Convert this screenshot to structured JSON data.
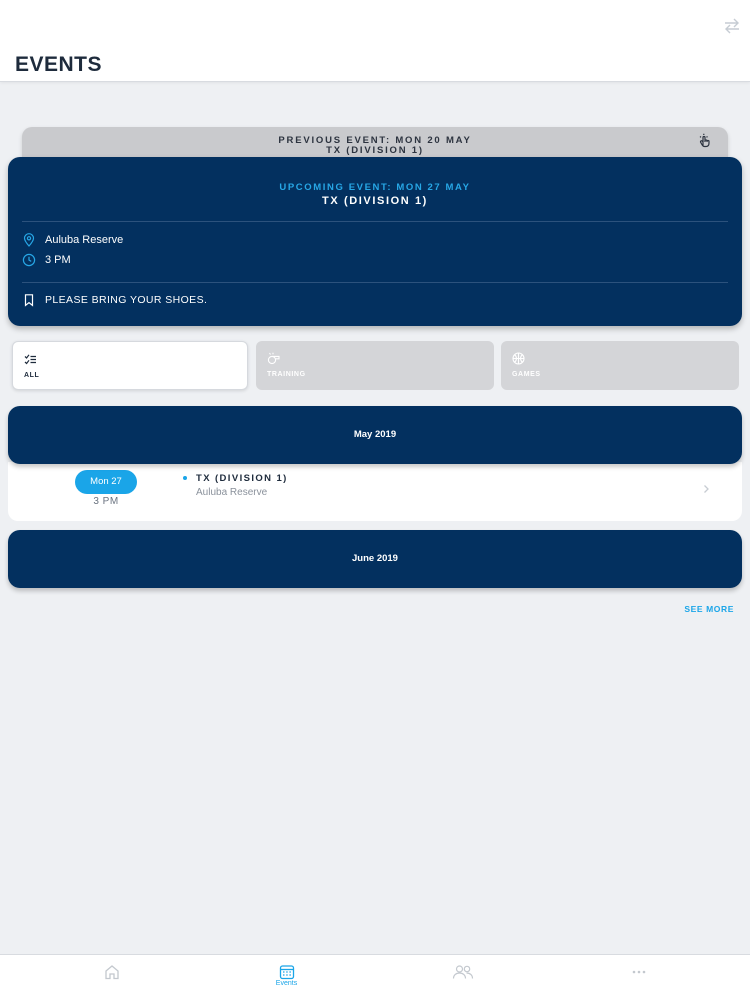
{
  "header": {
    "title": "EVENTS",
    "switch_icon": "swap-arrows-icon"
  },
  "previous_event": {
    "label": "PREVIOUS EVENT: MON 20 MAY",
    "title": "TX (DIVISION 1)",
    "icon": "tap-hand-icon"
  },
  "upcoming_event": {
    "label": "UPCOMING EVENT: MON 27 MAY",
    "title": "TX (DIVISION 1)",
    "location": "Auluba Reserve",
    "time": "3 PM",
    "note": "PLEASE BRING YOUR SHOES.",
    "accent_color": "#27a7e6"
  },
  "filters": [
    {
      "label": "ALL",
      "icon": "checklist-icon",
      "active": true
    },
    {
      "label": "TRAINING",
      "icon": "whistle-icon",
      "active": false
    },
    {
      "label": "GAMES",
      "icon": "ball-icon",
      "active": false
    }
  ],
  "months": [
    {
      "label": "May 2019",
      "events": [
        {
          "date": "Mon 27",
          "time": "3 PM",
          "title": "TX (DIVISION 1)",
          "venue": "Auluba Reserve"
        }
      ]
    },
    {
      "label": "June 2019",
      "events": []
    }
  ],
  "see_more": "SEE MORE",
  "tabbar": [
    {
      "label": "",
      "icon": "home-icon",
      "active": false
    },
    {
      "label": "Events",
      "icon": "calendar-icon",
      "active": true
    },
    {
      "label": "",
      "icon": "people-icon",
      "active": false
    },
    {
      "label": "",
      "icon": "more-dots-icon",
      "active": false
    }
  ],
  "colors": {
    "navy": "#03305f",
    "accent": "#1aa5e8",
    "background": "#eef0f3"
  }
}
